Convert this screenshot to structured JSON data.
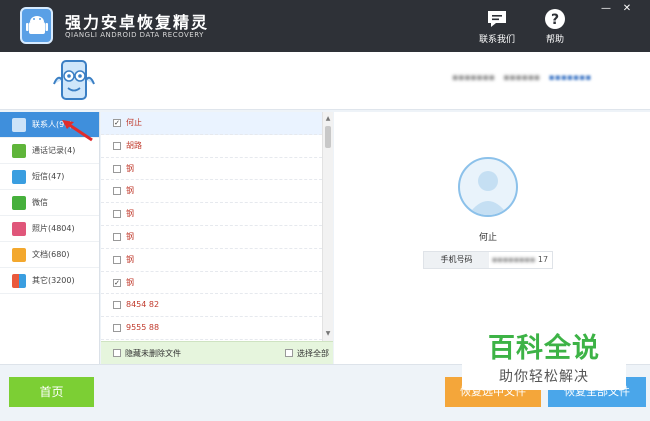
{
  "app": {
    "title": "强力安卓恢复精灵",
    "subtitle": "QIANGLI ANDROID DATA RECOVERY",
    "contact_us": "联系我们",
    "help": "帮助",
    "min_glyph": "—",
    "close_glyph": "✕"
  },
  "device": {
    "part1": "▪▪▪▪▪▪▪",
    "part2": "▪▪▪▪▪▪",
    "part3": "▪▪▪▪▪▪▪"
  },
  "categories": [
    {
      "label": "联系人(96)",
      "icon": "contacts-icon",
      "color": "#ffffff"
    },
    {
      "label": "通话记录(4)",
      "icon": "phone-icon",
      "color": "#5fb53a"
    },
    {
      "label": "短信(47)",
      "icon": "sms-icon",
      "color": "#3a9ee0"
    },
    {
      "label": "微信",
      "icon": "wechat-icon",
      "color": "#46b03c"
    },
    {
      "label": "照片(4804)",
      "icon": "photo-icon",
      "color": "#e0567a"
    },
    {
      "label": "文档(680)",
      "icon": "document-icon",
      "color": "#f3a82e"
    },
    {
      "label": "其它(3200)",
      "icon": "other-icon",
      "color": "#ea5a3d"
    }
  ],
  "contacts": [
    {
      "name": "何止",
      "checked": "✓"
    },
    {
      "name": "胡路",
      "checked": ""
    },
    {
      "name": "钢",
      "checked": ""
    },
    {
      "name": "钢",
      "checked": ""
    },
    {
      "name": "钢",
      "checked": ""
    },
    {
      "name": "钢",
      "checked": ""
    },
    {
      "name": "钢",
      "checked": ""
    },
    {
      "name": "钢",
      "checked": "✓"
    },
    {
      "name": "8454 82",
      "checked": ""
    },
    {
      "name": "9555 88",
      "checked": ""
    }
  ],
  "list_footer": {
    "hide_undeleted": "隐藏未删除文件",
    "select_all": "选择全部"
  },
  "detail": {
    "name": "何止",
    "phone_label": "手机号码",
    "phone_masked": "▪▪▪▪▪▪▪▪",
    "phone_suffix": "17"
  },
  "bottom": {
    "home": "首页",
    "recover_left": "恢复选中文件",
    "recover_right": "恢复全部文件"
  },
  "watermark": {
    "title": "百科全说",
    "subtitle": "助你轻松解决"
  }
}
